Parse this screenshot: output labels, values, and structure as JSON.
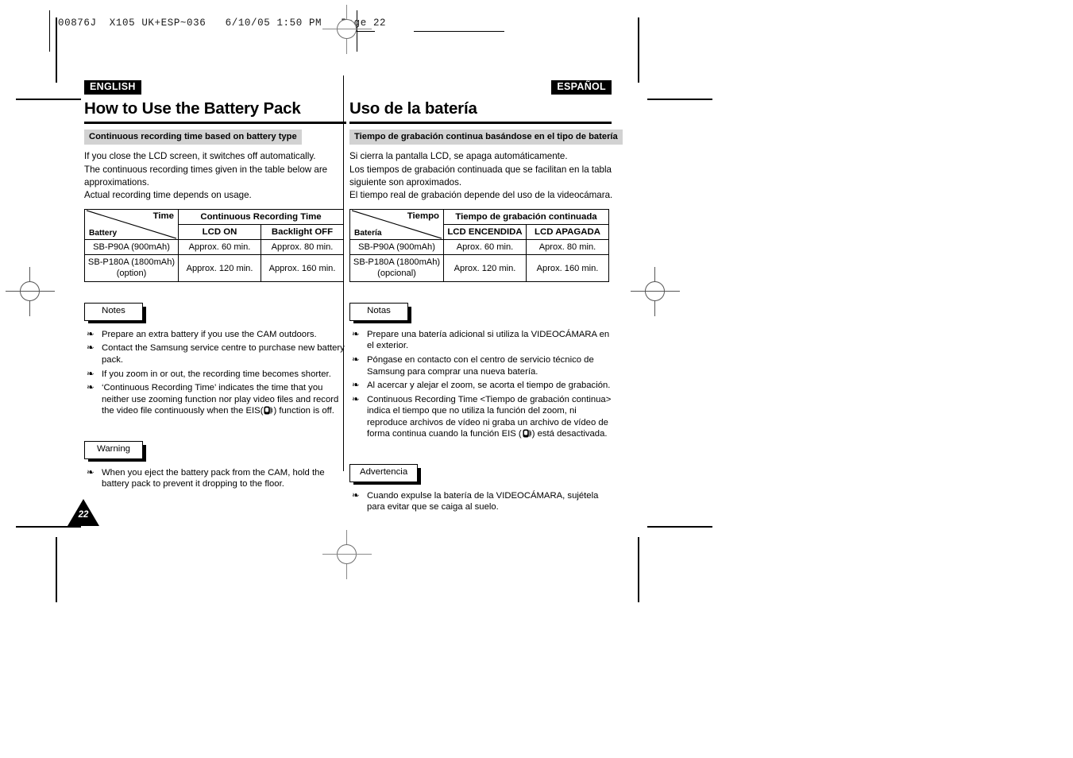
{
  "prepress": {
    "slug": "00876J  X105 UK+ESP~036   6/10/05 1:50 PM   Page 22"
  },
  "page_number": "22",
  "english": {
    "lang_tag": "ENGLISH",
    "title": "How to Use the Battery Pack",
    "section_bar": "Continuous recording time based on battery type",
    "intro_lines": [
      "If you close the LCD screen, it switches off automatically.",
      "The continuous recording times given in the table below are",
      "approximations.",
      "Actual recording time depends on usage."
    ],
    "table": {
      "corner_top": "Time",
      "corner_bottom": "Battery",
      "group_header": "Continuous Recording Time",
      "col_headers": [
        "LCD ON",
        "Backlight OFF"
      ],
      "rows": [
        {
          "battery": "SB-P90A (900mAh)",
          "battery_note": "",
          "values": [
            "Approx. 60 min.",
            "Approx. 80 min."
          ]
        },
        {
          "battery": "SB-P180A (1800mAh)",
          "battery_note": "(option)",
          "values": [
            "Approx. 120 min.",
            "Approx. 160 min."
          ]
        }
      ]
    },
    "notes": {
      "label": "Notes",
      "items": [
        {
          "pre": "Prepare an extra battery if you use the CAM outdoors.",
          "icon": false,
          "post": ""
        },
        {
          "pre": "Contact the Samsung service centre to purchase new battery pack.",
          "icon": false,
          "post": ""
        },
        {
          "pre": "If you zoom in or out, the recording time becomes shorter.",
          "icon": false,
          "post": ""
        },
        {
          "pre": "‘Continuous Recording Time’ indicates the time that you neither use zooming function nor play video files and record the video file continuously when the EIS(",
          "icon": true,
          "post": ") function is off."
        }
      ]
    },
    "warning": {
      "label": "Warning",
      "items": [
        {
          "pre": "When you eject the battery pack from the CAM, hold the battery pack to prevent it dropping to the floor.",
          "icon": false,
          "post": ""
        }
      ]
    }
  },
  "spanish": {
    "lang_tag": "ESPAÑOL",
    "title": "Uso de la batería",
    "section_bar": "Tiempo de grabación continua basándose en el tipo de batería",
    "intro_lines": [
      "Si cierra la pantalla LCD, se apaga automáticamente.",
      "Los tiempos de grabación continuada que se facilitan en la tabla",
      "siguiente son aproximados.",
      "El tiempo real de grabación depende del uso de la videocámara."
    ],
    "table": {
      "corner_top": "Tiempo",
      "corner_bottom": "Batería",
      "group_header": "Tiempo de grabación continuada",
      "col_headers": [
        "LCD ENCENDIDA",
        "LCD APAGADA"
      ],
      "rows": [
        {
          "battery": "SB-P90A (900mAh)",
          "battery_note": "",
          "values": [
            "Aprox. 60 min.",
            "Aprox. 80 min."
          ]
        },
        {
          "battery": "SB-P180A (1800mAh)",
          "battery_note": "(opcional)",
          "values": [
            "Aprox. 120 min.",
            "Aprox. 160 min."
          ]
        }
      ]
    },
    "notes": {
      "label": "Notas",
      "items": [
        {
          "pre": "Prepare una batería adicional si utiliza la VIDEOCÁMARA en el exterior.",
          "icon": false,
          "post": ""
        },
        {
          "pre": "Póngase en contacto con el centro de servicio técnico de Samsung para comprar una nueva batería.",
          "icon": false,
          "post": ""
        },
        {
          "pre": "Al acercar y alejar el zoom, se acorta el tiempo de grabación.",
          "icon": false,
          "post": ""
        },
        {
          "pre": "Continuous Recording Time <Tiempo de grabación continua> indica el tiempo que no utiliza la función del zoom, ni reproduce archivos de vídeo ni graba un archivo de vídeo de forma continua cuando la función EIS  (",
          "icon": true,
          "post": ") está desactivada."
        }
      ]
    },
    "warning": {
      "label": "Advertencia",
      "items": [
        {
          "pre": "Cuando expulse la batería de la VIDEOCÁMARA, sujétela para evitar que se caiga al suelo.",
          "icon": false,
          "post": ""
        }
      ]
    }
  },
  "icons": {
    "eis": "hand-shake-icon",
    "registration": "registration-mark-icon",
    "bullet": "clover-bullet-icon"
  }
}
